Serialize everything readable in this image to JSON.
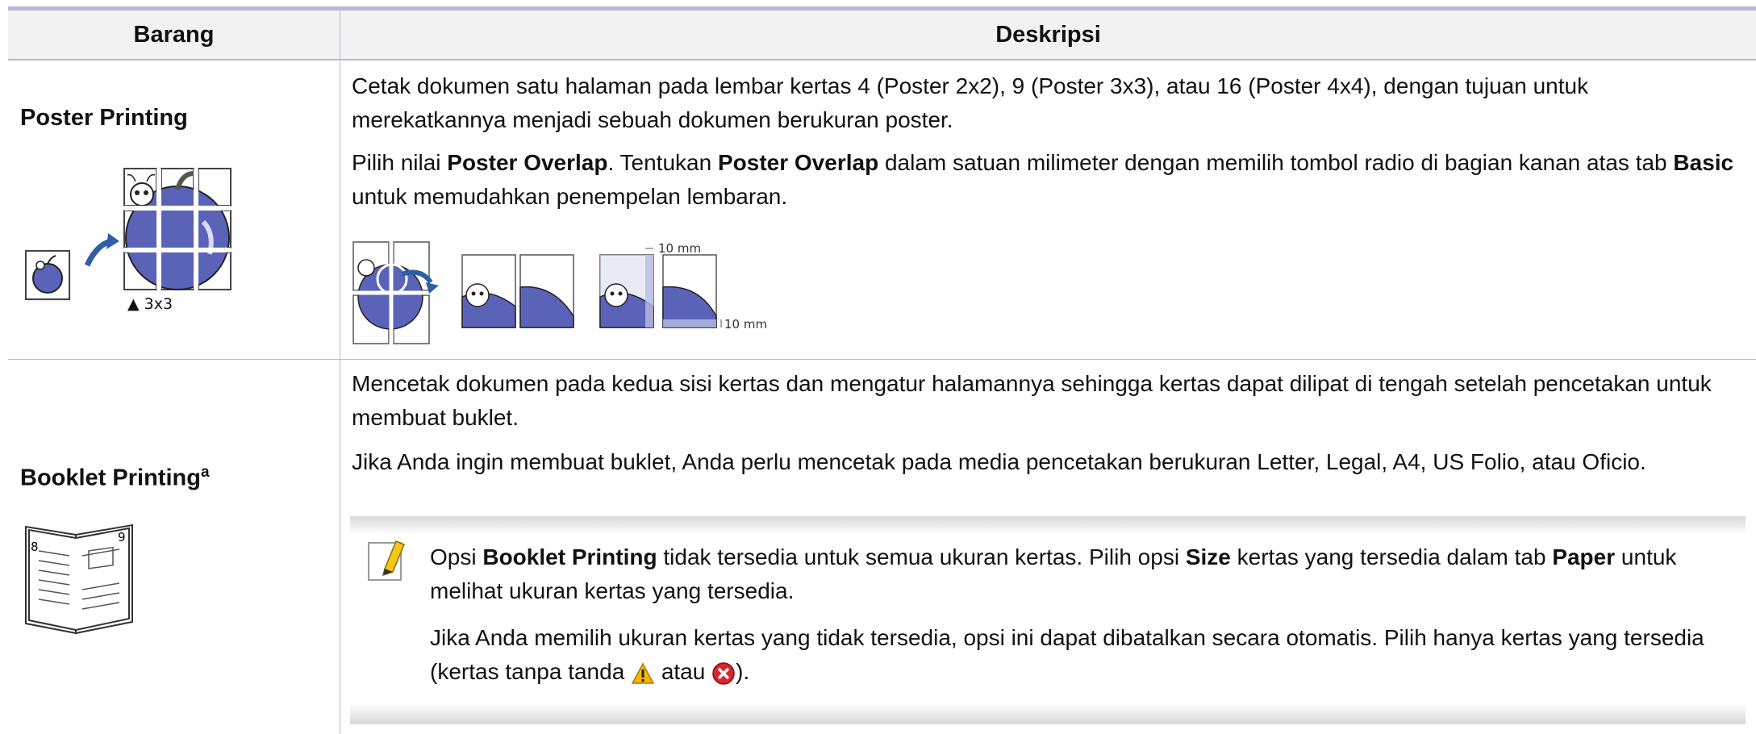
{
  "table": {
    "header": {
      "item": "Barang",
      "description": "Deskripsi"
    },
    "rows": [
      {
        "name": "Poster Printing",
        "caption": "▲ 3x3",
        "p1": "Cetak dokumen satu halaman pada lembar kertas 4 (Poster 2x2), 9 (Poster 3x3), atau 16 (Poster 4x4), dengan tujuan untuk merekatkannya menjadi sebuah dokumen berukuran poster.",
        "p2": {
          "a": "Pilih nilai ",
          "b": "Poster Overlap",
          "c": ". Tentukan ",
          "d": "Poster Overlap",
          "e": " dalam satuan milimeter dengan memilih tombol radio di bagian kanan atas tab ",
          "f": "Basic",
          "g": " untuk memudahkan penempelan lembaran."
        },
        "overlap_top": "10 mm",
        "overlap_right": "10 mm"
      },
      {
        "name": "Booklet Printing",
        "superscript": "a",
        "p1": "Mencetak dokumen pada kedua sisi kertas dan mengatur halamannya sehingga kertas dapat dilipat di tengah setelah pencetakan untuk membuat buklet.",
        "p2": "Jika Anda ingin membuat buklet, Anda perlu mencetak pada media pencetakan berukuran Letter, Legal, A4, US Folio, atau Oficio.",
        "book_pages": {
          "left": "8",
          "right": "9"
        },
        "note": {
          "n1": {
            "a": "Opsi ",
            "b": "Booklet Printing",
            "c": " tidak tersedia untuk semua ukuran kertas. Pilih opsi ",
            "d": "Size",
            "e": " kertas yang tersedia dalam tab ",
            "f": "Paper",
            "g": " untuk melihat ukuran kertas yang tersedia."
          },
          "n2": {
            "a": "Jika Anda memilih ukuran kertas yang tidak tersedia, opsi ini dapat dibatalkan secara otomatis. Pilih hanya kertas yang tersedia (kertas tanpa tanda ",
            "b": " atau ",
            "c": ")."
          }
        }
      }
    ]
  },
  "icons": [
    "note-pencil-icon",
    "warning-triangle-icon",
    "error-x-icon"
  ],
  "colors": {
    "rule": "#b9b6d6",
    "apple": "#5b63b8",
    "header_bg": "#f2f2f2"
  }
}
